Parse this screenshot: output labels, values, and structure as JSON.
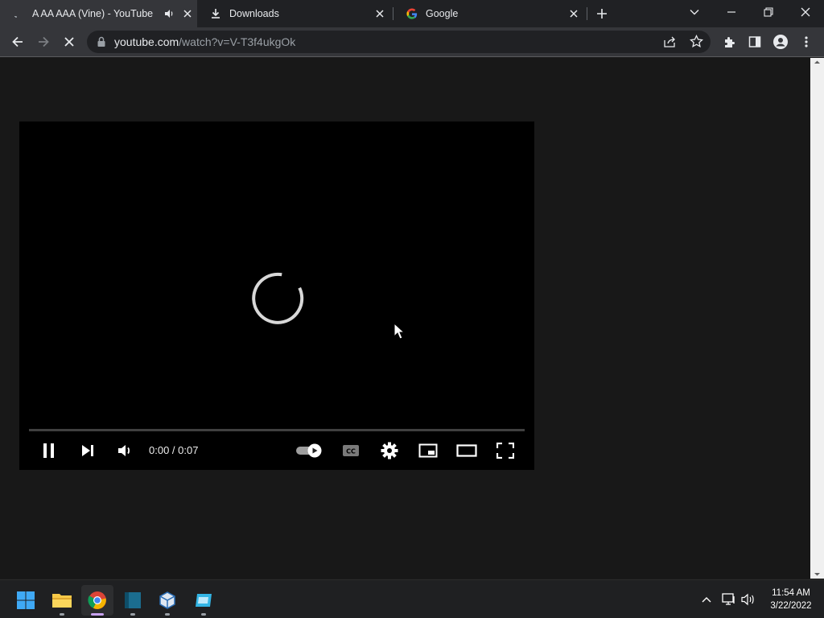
{
  "browser": {
    "tabs": [
      {
        "title": "A AA AAA (Vine) - YouTube",
        "active": true
      },
      {
        "title": "Downloads",
        "active": false
      },
      {
        "title": "Google",
        "active": false
      }
    ],
    "url_host": "youtube.com",
    "url_path": "/watch?v=V-T3f4ukgOk"
  },
  "player": {
    "time_display": "0:00 / 0:07",
    "progress_fraction": 0.0
  },
  "taskbar": {
    "clock_time": "11:54 AM",
    "clock_date": "3/22/2022"
  },
  "colors": {
    "tab_bar": "#202124",
    "toolbar": "#35363a",
    "page_bg": "#181818",
    "taskbar": "#1f2022"
  }
}
